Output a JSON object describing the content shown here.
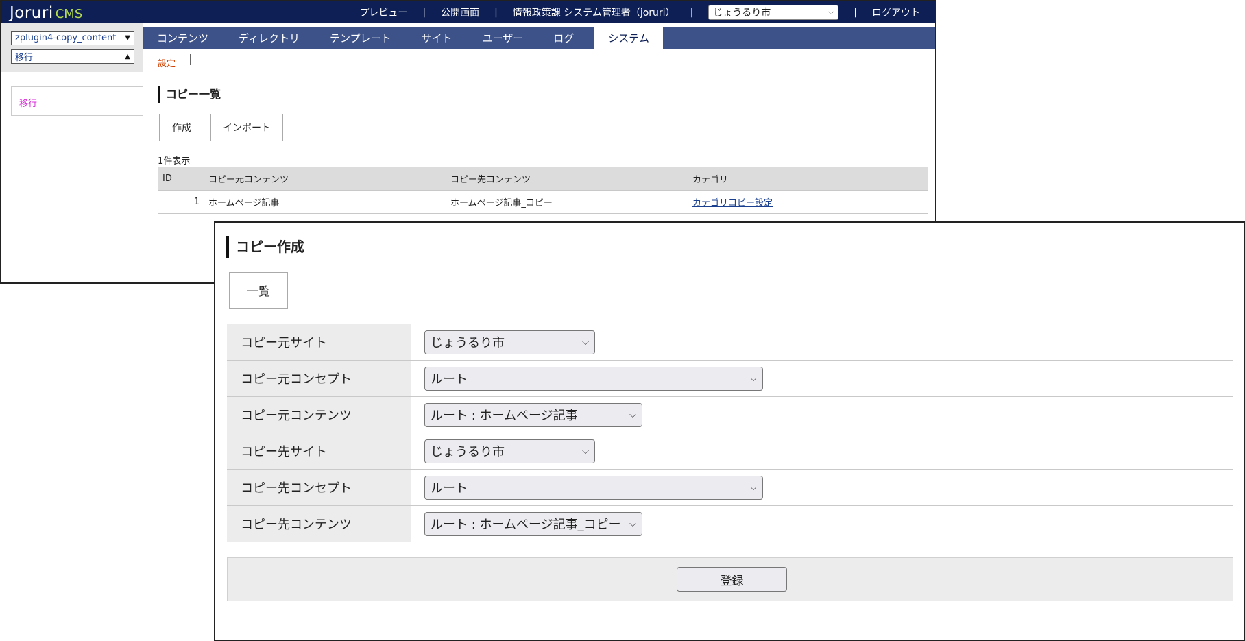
{
  "header": {
    "logo_main": "Joruri",
    "logo_sub": "CMS",
    "links": [
      "プレビュー",
      "公開画面",
      "情報政策課 システム管理者（joruri）"
    ],
    "site_select": "じょうるり市",
    "logout": "ログアウト"
  },
  "sidebar": {
    "content_select": "zplugin4-copy_content",
    "feature_select": "移行",
    "menu_item": "移行"
  },
  "nav": {
    "tabs": [
      "コンテンツ",
      "ディレクトリ",
      "テンプレート",
      "サイト",
      "ユーザー",
      "ログ",
      "システム"
    ],
    "active": "システム",
    "sub": "設定"
  },
  "list_page": {
    "title": "コピー一覧",
    "buttons": [
      "作成",
      "インポート"
    ],
    "count": "1件表示",
    "columns": [
      "ID",
      "コピー元コンテンツ",
      "コピー先コンテンツ",
      "カテゴリ"
    ],
    "rows": [
      {
        "id": "1",
        "source": "ホームページ記事",
        "dest": "ホームページ記事_コピー",
        "category": "カテゴリコピー設定"
      }
    ]
  },
  "form_page": {
    "title": "コピー作成",
    "list_button": "一覧",
    "fields": [
      {
        "label": "コピー元サイト",
        "value": "じょうるり市"
      },
      {
        "label": "コピー元コンセプト",
        "value": "ルート"
      },
      {
        "label": "コピー元コンテンツ",
        "value": "ルート : ホームページ記事"
      },
      {
        "label": "コピー先サイト",
        "value": "じょうるり市"
      },
      {
        "label": "コピー先コンセプト",
        "value": "ルート"
      },
      {
        "label": "コピー先コンテンツ",
        "value": "ルート : ホームページ記事_コピー"
      }
    ],
    "submit": "登録"
  },
  "colors": {
    "topbar": "#0d1f55",
    "nav": "#3d5288",
    "logo_accent": "#b6dd4c",
    "subnav_link": "#d04000",
    "sidebar_link": "#d82cd8"
  },
  "icons": {
    "dropdown": "chevron-down-icon",
    "select_down": "triangle-down-icon",
    "select_up": "triangle-up-icon"
  }
}
